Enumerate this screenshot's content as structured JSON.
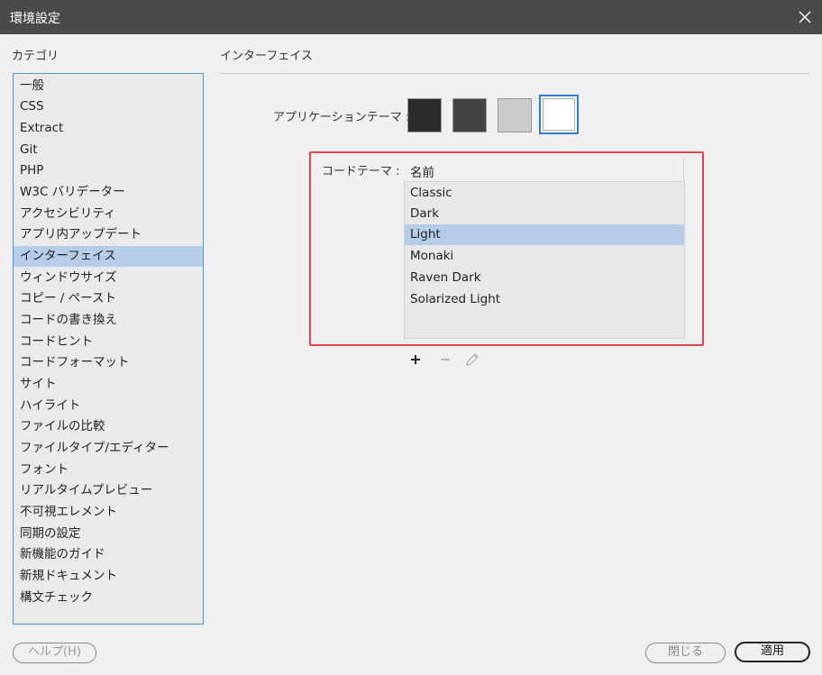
{
  "window": {
    "title": "環境設定"
  },
  "sidebar": {
    "header": "カテゴリ",
    "items": [
      {
        "label": "一般"
      },
      {
        "label": "CSS"
      },
      {
        "label": "Extract"
      },
      {
        "label": "Git"
      },
      {
        "label": "PHP"
      },
      {
        "label": "W3C バリデーター"
      },
      {
        "label": "アクセシビリティ"
      },
      {
        "label": "アプリ内アップデート"
      },
      {
        "label": "インターフェイス"
      },
      {
        "label": "ウィンドウサイズ"
      },
      {
        "label": "コピー / ペースト"
      },
      {
        "label": "コードの書き換え"
      },
      {
        "label": "コードヒント"
      },
      {
        "label": "コードフォーマット"
      },
      {
        "label": "サイト"
      },
      {
        "label": "ハイライト"
      },
      {
        "label": "ファイルの比較"
      },
      {
        "label": "ファイルタイプ/エディター"
      },
      {
        "label": "フォント"
      },
      {
        "label": "リアルタイムプレビュー"
      },
      {
        "label": "不可視エレメント"
      },
      {
        "label": "同期の設定"
      },
      {
        "label": "新機能のガイド"
      },
      {
        "label": "新規ドキュメント"
      },
      {
        "label": "構文チェック"
      }
    ],
    "selected_label": "インターフェイス"
  },
  "panel": {
    "title": "インターフェイス",
    "app_theme": {
      "label": "アプリケーションテーマ :",
      "swatches": [
        {
          "name": "darkest",
          "color": "#2b2b2b"
        },
        {
          "name": "dark",
          "color": "#434343"
        },
        {
          "name": "light",
          "color": "#cbcbcb"
        },
        {
          "name": "lightest",
          "color": "#ffffff"
        }
      ],
      "selected": "lightest"
    },
    "code_theme": {
      "label": "コードテーマ :",
      "column_header": "名前",
      "items": [
        {
          "label": "Classic"
        },
        {
          "label": "Dark"
        },
        {
          "label": "Light"
        },
        {
          "label": "Monaki"
        },
        {
          "label": "Raven Dark"
        },
        {
          "label": "Solarized Light"
        }
      ],
      "selected_label": "Light",
      "tools": [
        {
          "name": "add-icon"
        },
        {
          "name": "remove-icon"
        },
        {
          "name": "edit-icon"
        }
      ]
    }
  },
  "footer": {
    "help_label": "ヘルプ(H)",
    "close_label": "閉じる",
    "apply_label": "適用"
  },
  "colors": {
    "titlebar": "#4a4a4a",
    "selection": "#b5cde9",
    "focus_border": "#4f93d8",
    "highlight_border": "#e0454d"
  }
}
